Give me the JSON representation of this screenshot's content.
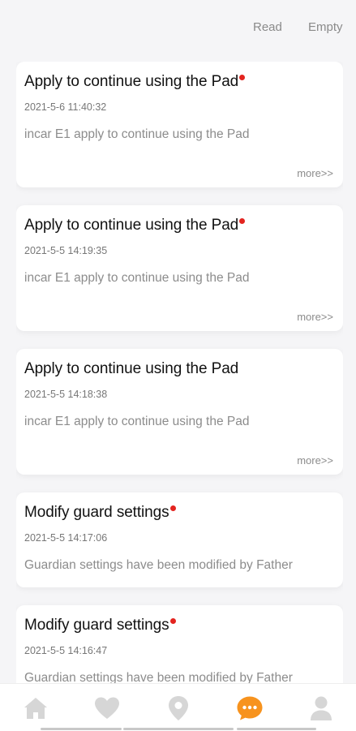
{
  "header": {
    "read_label": "Read",
    "empty_label": "Empty"
  },
  "messages": [
    {
      "title": "Apply to continue using the Pad",
      "unread": true,
      "time": "2021-5-6 11:40:32",
      "body": "incar E1 apply to continue using the Pad",
      "more_label": "more>>"
    },
    {
      "title": "Apply to continue using the Pad",
      "unread": true,
      "time": "2021-5-5 14:19:35",
      "body": "incar E1 apply to continue using the Pad",
      "more_label": "more>>"
    },
    {
      "title": "Apply to continue using the Pad",
      "unread": false,
      "time": "2021-5-5 14:18:38",
      "body": "incar E1 apply to continue using the Pad",
      "more_label": "more>>"
    },
    {
      "title": "Modify guard settings",
      "unread": true,
      "time": "2021-5-5 14:17:06",
      "body": "Guardian settings have been modified by Father"
    },
    {
      "title": "Modify guard settings",
      "unread": true,
      "time": "2021-5-5 14:16:47",
      "body": "Guardian settings have been modified by Father"
    }
  ],
  "tabbar": {
    "tabs": [
      {
        "icon": "home-icon",
        "active": false
      },
      {
        "icon": "heart-icon",
        "active": false
      },
      {
        "icon": "location-pin-icon",
        "active": false
      },
      {
        "icon": "message-icon",
        "active": true
      },
      {
        "icon": "profile-icon",
        "active": false
      }
    ],
    "active_color": "#f7931e",
    "inactive_color": "#d6d6d6"
  },
  "colors": {
    "unread_dot": "#e3241f",
    "background": "#f5f5f7"
  }
}
